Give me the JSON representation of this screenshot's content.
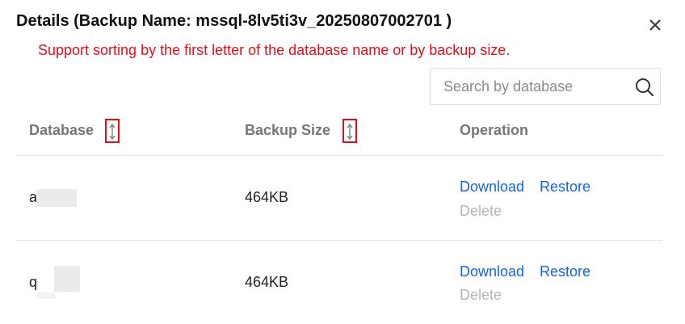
{
  "dialog": {
    "title": "Details (Backup Name: mssql-8lv5ti3v_20250807002701 )",
    "annotation": "Support sorting by the first letter of the database name or by backup size."
  },
  "search": {
    "placeholder": "Search by database",
    "value": ""
  },
  "table": {
    "columns": [
      {
        "label": "Database",
        "sortable": true
      },
      {
        "label": "Backup Size",
        "sortable": true
      },
      {
        "label": "Operation",
        "sortable": false
      }
    ],
    "rows": [
      {
        "database": "a",
        "backup_size": "464KB",
        "actions": {
          "download": "Download",
          "restore": "Restore",
          "delete": "Delete"
        }
      },
      {
        "database": "q",
        "backup_size": "464KB",
        "actions": {
          "download": "Download",
          "restore": "Restore",
          "delete": "Delete"
        }
      }
    ]
  },
  "colors": {
    "annotation": "#e0101a",
    "link": "#1464dc",
    "disabled": "#b5b5b5",
    "header_text": "#777777"
  },
  "icons": {
    "close": "close-icon",
    "search": "search-icon",
    "sort": "sort-arrows-icon"
  }
}
